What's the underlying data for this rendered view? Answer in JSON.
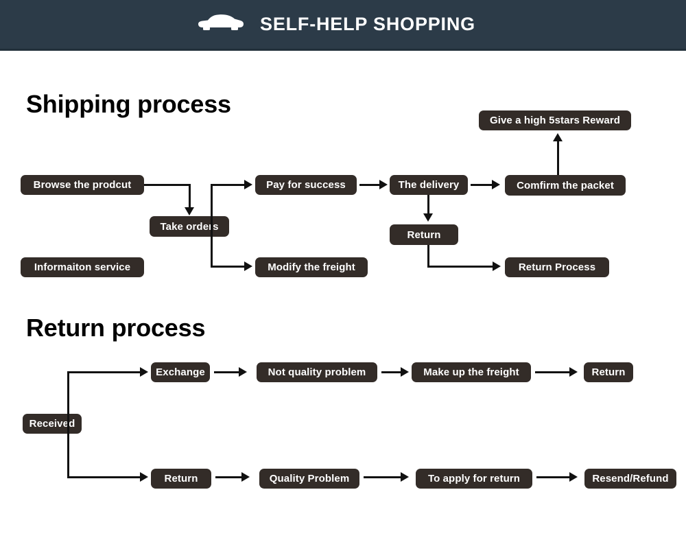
{
  "header": {
    "title": "SELF-HELP SHOPPING",
    "icon": "car-icon",
    "background_color": "#2c3b48",
    "text_color": "#ffffff"
  },
  "theme": {
    "node_background": "#332c28",
    "node_text": "#ffffff",
    "connector_color": "#111111",
    "page_background": "#ffffff"
  },
  "sections": [
    {
      "id": "shipping",
      "title": "Shipping process",
      "nodes": {
        "browse": "Browse the prodcut",
        "information": "Informaiton service",
        "take_orders": "Take orders",
        "pay": "Pay for success",
        "modify": "Modify the freight",
        "delivery": "The delivery",
        "return": "Return",
        "confirm": "Comfirm the packet",
        "reward": "Give a high 5stars Reward",
        "return_process": "Return Process"
      }
    },
    {
      "id": "return",
      "title": "Return process",
      "nodes": {
        "received": "Received",
        "exchange": "Exchange",
        "not_quality": "Not quality problem",
        "make_up": "Make up the freight",
        "return_top": "Return",
        "return_bottom": "Return",
        "quality": "Quality Problem",
        "apply": "To apply for return",
        "resend": "Resend/Refund"
      }
    }
  ]
}
